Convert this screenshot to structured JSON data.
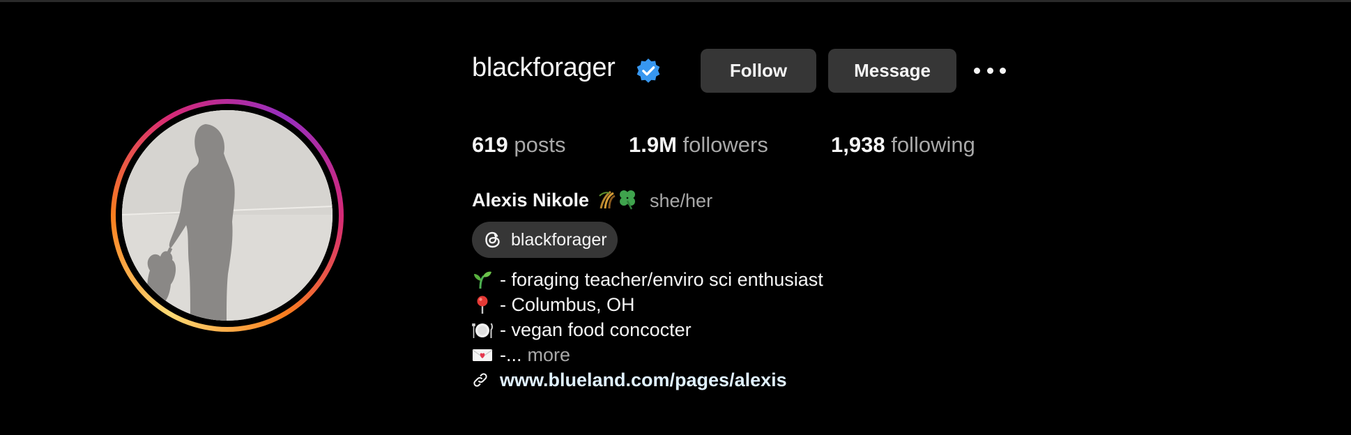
{
  "profile": {
    "username": "blackforager",
    "verified": true,
    "full_name": "Alexis Nikole",
    "name_emoji": [
      "sheaf-of-rice-icon",
      "four-leaf-clover-icon"
    ],
    "pronouns": "she/her"
  },
  "actions": {
    "follow_label": "Follow",
    "message_label": "Message",
    "more_icon": "more-options-icon"
  },
  "stats": {
    "posts_count": "619",
    "posts_label": "posts",
    "followers_count": "1.9M",
    "followers_label": "followers",
    "following_count": "1,938",
    "following_label": "following"
  },
  "threads": {
    "icon": "threads-icon",
    "label": "blackforager"
  },
  "bio": {
    "lines": [
      {
        "icon": "seedling-icon",
        "text": "- foraging teacher/enviro sci enthusiast"
      },
      {
        "icon": "round-pushpin-icon",
        "text": "- Columbus, OH"
      },
      {
        "icon": "fork-knife-plate-icon",
        "text": "- vegan food concocter"
      },
      {
        "icon": "love-letter-icon",
        "text": "-..."
      }
    ],
    "more_label": "more"
  },
  "link": {
    "icon": "link-icon",
    "text": "www.blueland.com/pages/alexis"
  },
  "colors": {
    "background": "#000000",
    "button_bg": "#363636",
    "muted_text": "#a8a8a8",
    "verified_blue": "#3797f0",
    "link_text": "#e0f1ff"
  }
}
